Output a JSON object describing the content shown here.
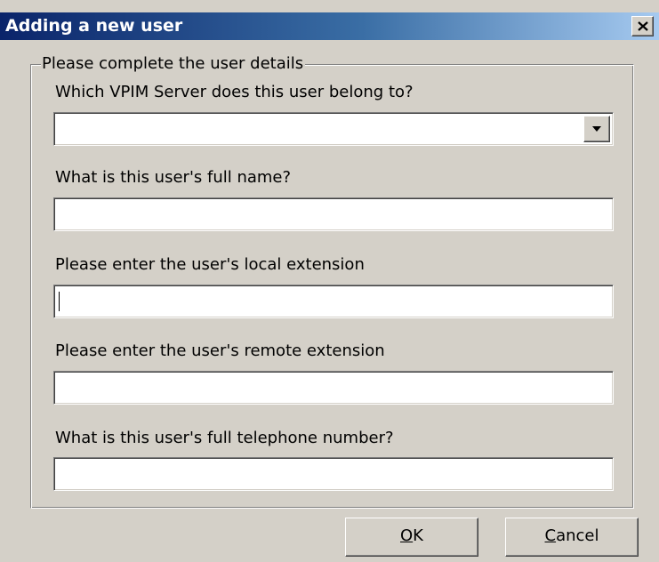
{
  "window": {
    "title": "Adding a new user"
  },
  "group": {
    "legend": "Please complete the user details"
  },
  "fields": {
    "server_label": "Which VPIM Server does this user belong to?",
    "server_value": "",
    "fullname_label": "What is this user's full name?",
    "fullname_value": "",
    "local_ext_label": "Please enter the user's local extension",
    "local_ext_value": "",
    "remote_ext_label": "Please enter the user's remote extension",
    "remote_ext_value": "",
    "phone_label": "What is this user's full telephone number?",
    "phone_value": ""
  },
  "buttons": {
    "ok_mnemonic": "O",
    "ok_rest": "K",
    "cancel_mnemonic": "C",
    "cancel_rest": "ancel"
  }
}
